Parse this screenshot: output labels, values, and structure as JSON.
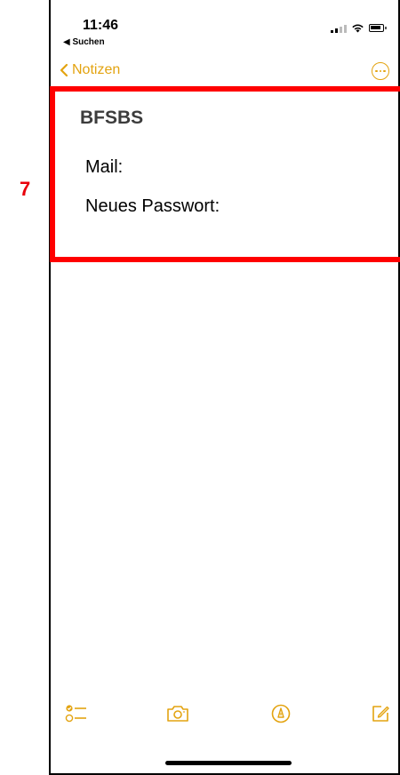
{
  "annotation": {
    "step_number": "7"
  },
  "status_bar": {
    "time": "11:46",
    "back_app": "◀ Suchen"
  },
  "nav": {
    "back_label": "Notizen"
  },
  "note": {
    "title": "BFSBS",
    "lines": [
      "Mail:",
      "Neues Passwort:"
    ]
  },
  "toolbar": {
    "items": [
      "checklist-icon",
      "camera-icon",
      "markup-icon",
      "compose-icon"
    ]
  },
  "colors": {
    "accent": "#e3a310",
    "highlight": "#ff0000",
    "step_number": "#e8000b"
  }
}
